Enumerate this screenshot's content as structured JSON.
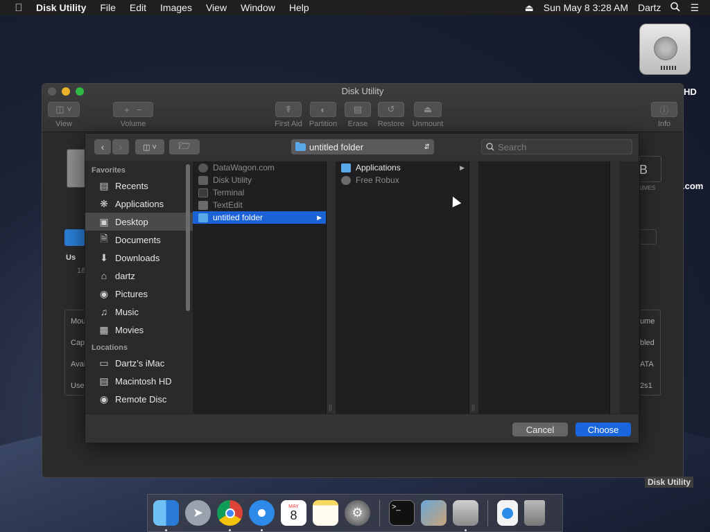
{
  "menubar": {
    "apple_icon": "apple-icon",
    "app_name": "Disk Utility",
    "menus": [
      "File",
      "Edit",
      "Images",
      "View",
      "Window",
      "Help"
    ],
    "clock": "Sun May 8  3:28 AM",
    "user": "Dartz"
  },
  "desktop": {
    "hd_label_fragment": "HD",
    "com_fragment": ".com"
  },
  "disk_utility": {
    "title": "Disk Utility",
    "toolbar": {
      "view": "View",
      "volume": "Volume",
      "first_aid": "First Aid",
      "partition": "Partition",
      "erase": "Erase",
      "restore": "Restore",
      "unmount": "Unmount",
      "info": "Info"
    },
    "background_fragments": {
      "us": "Us",
      "n18": "18",
      "mou": "Mou",
      "cap": "Cap",
      "avai": "Avai",
      "use": "Use",
      "ume": "ume",
      "bled": "bled",
      "ata": "ATA",
      "s2s1": "2s1",
      "b": "B",
      "umes": "UMES"
    }
  },
  "dialog": {
    "location": "untitled folder",
    "search_placeholder": "Search",
    "sidebar": {
      "favorites_header": "Favorites",
      "favorites": [
        {
          "label": "Recents",
          "icon": "clock-icon"
        },
        {
          "label": "Applications",
          "icon": "applications-icon"
        },
        {
          "label": "Desktop",
          "icon": "desktop-icon",
          "selected": true
        },
        {
          "label": "Documents",
          "icon": "document-icon"
        },
        {
          "label": "Downloads",
          "icon": "download-icon"
        },
        {
          "label": "dartz",
          "icon": "home-icon"
        },
        {
          "label": "Pictures",
          "icon": "camera-icon"
        },
        {
          "label": "Music",
          "icon": "music-icon"
        },
        {
          "label": "Movies",
          "icon": "film-icon"
        }
      ],
      "locations_header": "Locations",
      "locations": [
        {
          "label": "Dartz’s iMac",
          "icon": "imac-icon"
        },
        {
          "label": "Macintosh HD",
          "icon": "hard-drive-icon"
        },
        {
          "label": "Remote Disc",
          "icon": "disc-icon"
        }
      ]
    },
    "column1": [
      {
        "label": "DataWagon.com",
        "dim": true
      },
      {
        "label": "Disk Utility",
        "dim": true
      },
      {
        "label": "Terminal",
        "dim": true
      },
      {
        "label": "TextEdit",
        "dim": true
      },
      {
        "label": "untitled folder",
        "dim": false,
        "selected": true
      }
    ],
    "column2": [
      {
        "label": "Applications",
        "dim": false
      },
      {
        "label": "Free Robux",
        "dim": true
      }
    ],
    "cancel_label": "Cancel",
    "choose_label": "Choose"
  },
  "tooltip": "Disk Utility",
  "dock": {
    "apps": [
      {
        "name": "Finder",
        "icon": "finder-icon",
        "running": true
      },
      {
        "name": "Launchpad",
        "icon": "rocket-icon",
        "running": false
      },
      {
        "name": "Chrome",
        "icon": "chrome-icon",
        "running": true
      },
      {
        "name": "Safari",
        "icon": "compass-icon",
        "running": true
      },
      {
        "name": "Calendar",
        "icon": "calendar-icon",
        "running": false,
        "month": "MAY",
        "day": "8"
      },
      {
        "name": "Notes",
        "icon": "notes-icon",
        "running": false
      },
      {
        "name": "System Preferences",
        "icon": "gear-icon",
        "running": false
      },
      {
        "name": "Terminal",
        "icon": "terminal-icon",
        "running": false
      },
      {
        "name": "Preview",
        "icon": "preview-icon",
        "running": false
      },
      {
        "name": "Disk Utility",
        "icon": "disk-utility-icon",
        "running": true
      },
      {
        "name": "Downloads",
        "icon": "downloads-stack-icon",
        "running": false
      },
      {
        "name": "Trash",
        "icon": "trash-icon",
        "running": false
      }
    ]
  }
}
